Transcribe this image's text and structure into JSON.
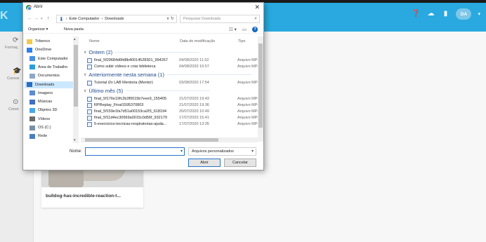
{
  "app": {
    "top_icons": [
      "help-icon",
      "cloud-upload-icon",
      "notifications-icon"
    ],
    "avatar_initials": "DA",
    "colors": {
      "brand": "#29a9df",
      "dialog_accent": "#2b73c9"
    }
  },
  "leftnav": {
    "items": [
      {
        "label": "Formaç",
        "icon": "refresh-icon"
      },
      {
        "label": "Cursos",
        "icon": "graduation-icon"
      },
      {
        "label": "Const",
        "icon": "play-icon"
      }
    ]
  },
  "card": {
    "title": "bulldog-has-incredible-reaction-t..."
  },
  "dialog": {
    "title": "Abrir",
    "address": {
      "crumb1": "Este Computador",
      "sep": "›",
      "crumb2": "Downloads"
    },
    "search_placeholder": "Pesquisar Downloads",
    "toolbar": {
      "organize": "Organizar ▾",
      "new_folder": "Nova pasta"
    },
    "sidebar": [
      {
        "label": "Tribenco",
        "icon": "folder-icon"
      },
      {
        "label": "OneDrive",
        "icon": "cloud-icon"
      },
      {
        "label": "Este Computador",
        "icon": "computer-icon"
      },
      {
        "label": "Área de Trabalho",
        "icon": "desktop-icon"
      },
      {
        "label": "Documentos",
        "icon": "documents-icon"
      },
      {
        "label": "Downloads",
        "icon": "downloads-icon",
        "selected": true
      },
      {
        "label": "Imagens",
        "icon": "images-icon"
      },
      {
        "label": "Músicas",
        "icon": "music-icon"
      },
      {
        "label": "Objetos 3D",
        "icon": "objects-3d-icon"
      },
      {
        "label": "Vídeos",
        "icon": "videos-icon"
      },
      {
        "label": "OS (C:)",
        "icon": "drive-icon"
      },
      {
        "label": "Rede",
        "icon": "network-icon"
      }
    ],
    "columns": {
      "name": "Nome",
      "date": "Data de modificação",
      "type": "Tipo"
    },
    "groups": [
      {
        "label": "Ontem (2)",
        "files": [
          {
            "name": "final_5f29684d6fd8b40014528301_994267",
            "date": "04/08/2020 11:32",
            "type": "Arquivo MP4"
          },
          {
            "name": "Como subir vídeos e criar biblioteca",
            "date": "04/08/2020 10:57",
            "type": "Arquivo MP4"
          }
        ]
      },
      {
        "label": "Anteriormente nesta semana (1)",
        "files": [
          {
            "name": "Tutorial i2x LAB Mentoria (Mentor)",
            "date": "03/08/2020 17:54",
            "type": "Arquivo MP4"
          }
        ]
      },
      {
        "label": "Último mês (5)",
        "files": [
          {
            "name": "final_5f176e19fc2b3f0015b7eee9_155405",
            "date": "21/07/2020 19:43",
            "type": "Arquivo MP4"
          },
          {
            "name": "RPReplay_Final1595370803",
            "date": "21/07/2020 19:36",
            "type": "Arquivo MP4"
          },
          {
            "name": "final_5f159e1fa7d51a00153ca2f3_618194",
            "date": "20/07/2020 10:49",
            "type": "Arquivo MP4"
          },
          {
            "name": "final_5f11d4ec30569a0015c0d56f_932179",
            "date": "17/07/2020 15:41",
            "type": "Arquivo MP4"
          },
          {
            "name": "5-exercicios-tecnicas-respiratorias-ajuda...",
            "date": "17/07/2020 13:35",
            "type": "Arquivo MP4"
          }
        ]
      }
    ],
    "filename_label": "Nome:",
    "filename_value": "",
    "filter": "Arquivos personalizados",
    "open_label": "Abrir",
    "cancel_label": "Cancelar"
  }
}
